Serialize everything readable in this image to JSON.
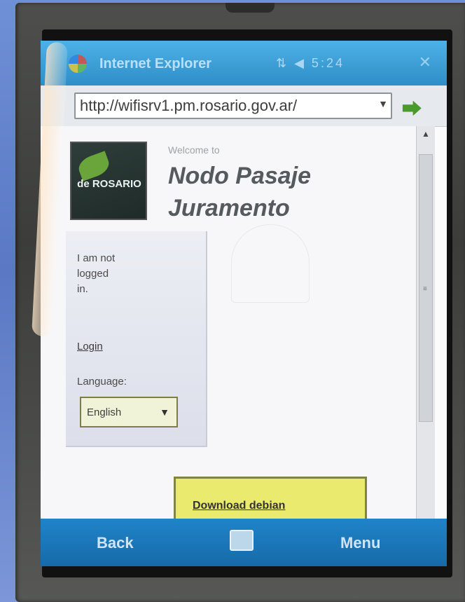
{
  "window": {
    "app_title": "Internet Explorer",
    "status_glyphs": "⇅ ◀ 5:24",
    "close_label": "✕"
  },
  "address_bar": {
    "url": "http://wifisrv1.pm.rosario.gov.ar/"
  },
  "page": {
    "logo_text": "de ROSARIO",
    "welcome_text": "Welcome to",
    "site_title": "Nodo Pasaje Juramento",
    "login_status": "I am not logged in.",
    "login_link": "Login",
    "language_label": "Language:",
    "language_selected": "English",
    "download_link": "Download debian"
  },
  "softkeys": {
    "left": "Back",
    "right": "Menu"
  },
  "colors": {
    "title_bar": "#2f8ec8",
    "softkey_bar": "#1f84c9",
    "download_box": "#e9ea6e"
  }
}
